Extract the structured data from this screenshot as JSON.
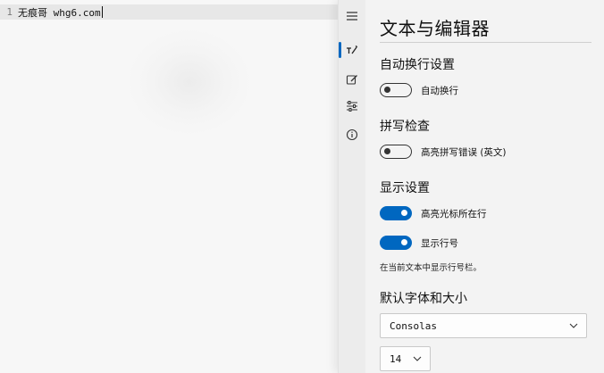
{
  "editor": {
    "line_number": "1",
    "line_text": "无痕哥 whg6.com"
  },
  "rail": {
    "items": [
      {
        "icon": "hamburger-menu-icon"
      },
      {
        "icon": "text-editor-icon",
        "active": true
      },
      {
        "icon": "edit-note-icon"
      },
      {
        "icon": "sliders-icon"
      },
      {
        "icon": "info-icon"
      }
    ]
  },
  "panel": {
    "title": "文本与编辑器",
    "word_wrap": {
      "heading": "自动换行设置",
      "toggle_label": "自动换行",
      "state": "off"
    },
    "spell_check": {
      "heading": "拼写检查",
      "toggle_label": "高亮拼写错误 (英文)",
      "state": "off"
    },
    "display": {
      "heading": "显示设置",
      "highlight_line_label": "高亮光标所在行",
      "highlight_line_state": "on",
      "line_numbers_label": "显示行号",
      "line_numbers_state": "on",
      "hint": "在当前文本中显示行号栏。"
    },
    "font": {
      "heading": "默认字体和大小",
      "family_value": "Consolas",
      "size_value": "14"
    }
  },
  "colors": {
    "accent": "#0067c0",
    "panel_bg": "#f3f3f3",
    "editor_bg": "#f7f7f7",
    "active_line_bg": "#e7e7e7"
  }
}
